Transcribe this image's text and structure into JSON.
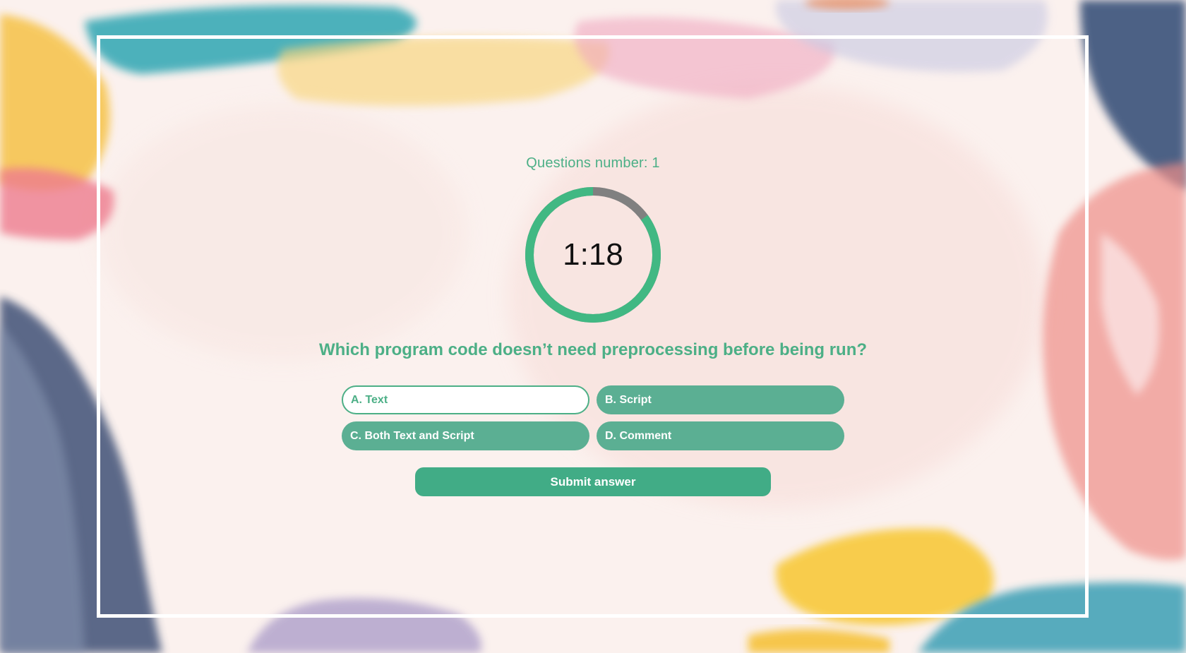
{
  "quiz": {
    "question_number_label": "Questions number: 1",
    "timer_text": "1:18",
    "timer_remaining_fraction": 0.85,
    "question": "Which program code doesn’t need preprocessing before being run?",
    "options": [
      {
        "label": "A. Text",
        "selected": true
      },
      {
        "label": "B. Script",
        "selected": false
      },
      {
        "label": "C. Both Text and Script",
        "selected": false
      },
      {
        "label": "D. Comment",
        "selected": false
      }
    ],
    "submit_label": "Submit answer"
  },
  "colors": {
    "accent": "#4caf86",
    "button": "#41ac86",
    "option": "#5baf93",
    "timer_track": "#808080",
    "background": "#fbf1ee"
  }
}
